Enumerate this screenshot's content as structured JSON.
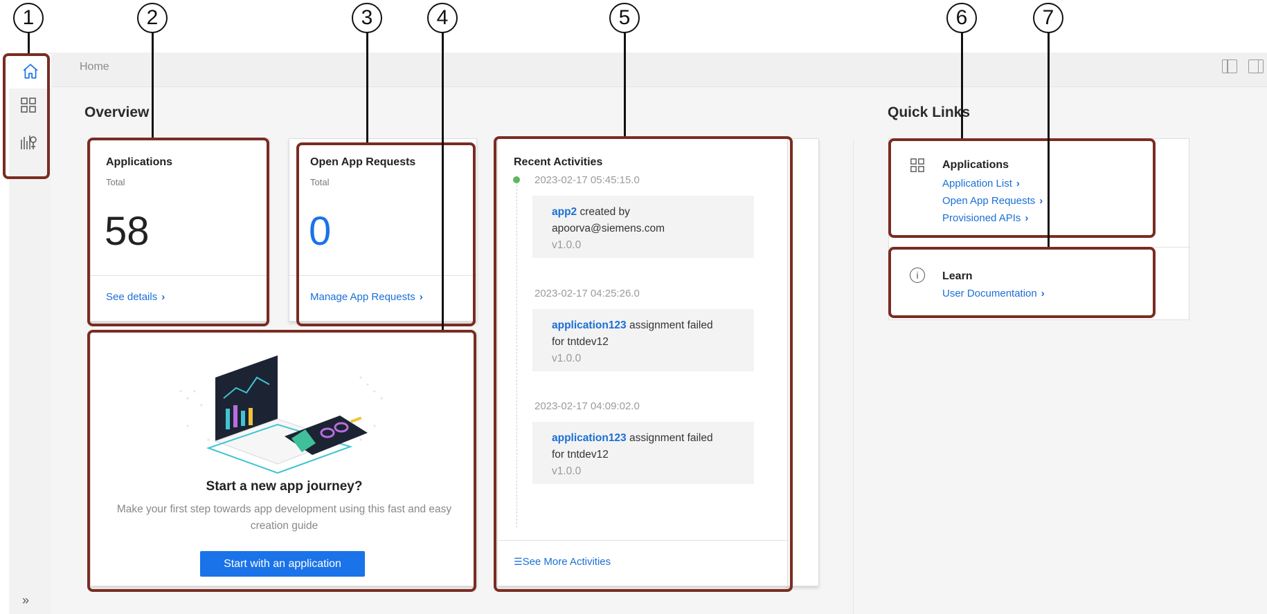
{
  "breadcrumb": {
    "home": "Home"
  },
  "sidebar": {
    "items": [
      {
        "icon": "home-icon",
        "active": true
      },
      {
        "icon": "grid-icon",
        "active": false
      },
      {
        "icon": "api-icon",
        "active": false
      }
    ],
    "expand_label": "»"
  },
  "overview": {
    "title": "Overview",
    "applications_card": {
      "title": "Applications",
      "subtitle": "Total",
      "count": "58",
      "link": "See details"
    },
    "requests_card": {
      "title": "Open App Requests",
      "subtitle": "Total",
      "count": "0",
      "link": "Manage App Requests"
    },
    "journey_card": {
      "title": "Start a new app journey?",
      "description": "Make your first step towards app development using this fast and easy creation guide",
      "button": "Start with an application"
    },
    "activities": {
      "title": "Recent Activities",
      "items": [
        {
          "timestamp": "2023-02-17 05:45:15.0",
          "name": "app2",
          "text": " created by",
          "line2": "apoorva@siemens.com",
          "version": "v1.0.0"
        },
        {
          "timestamp": "2023-02-17 04:25:26.0",
          "name": "application123",
          "text": " assignment failed",
          "line2": "for tntdev12",
          "version": "v1.0.0"
        },
        {
          "timestamp": "2023-02-17 04:09:02.0",
          "name": "application123",
          "text": " assignment failed",
          "line2": "for tntdev12",
          "version": "v1.0.0"
        }
      ],
      "see_more": "See More Activities"
    }
  },
  "quick_links": {
    "title": "Quick Links",
    "applications": {
      "label": "Applications",
      "links": [
        "Application List",
        "Open App Requests",
        "Provisioned APIs"
      ]
    },
    "learn": {
      "label": "Learn",
      "links": [
        "User Documentation"
      ]
    }
  },
  "annotations": [
    "1",
    "2",
    "3",
    "4",
    "5",
    "6",
    "7"
  ],
  "colors": {
    "accent": "#1a73e8",
    "annotation": "#7a2c22",
    "status_dot": "#5cb85c"
  }
}
